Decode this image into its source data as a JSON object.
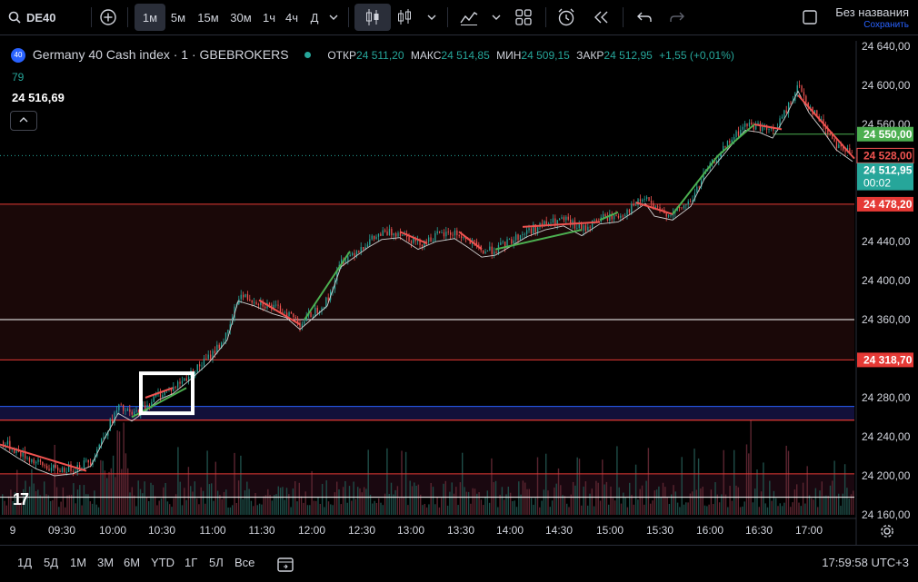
{
  "toolbar": {
    "symbol": "DE40",
    "timeframes": [
      "1м",
      "5м",
      "15м",
      "30м",
      "1ч",
      "4ч",
      "Д"
    ],
    "active_timeframe": "1м",
    "layout_title": "Без названия",
    "save_label": "Сохранить"
  },
  "legend": {
    "badge": "40",
    "title": "Germany 40 Cash index · 1 · GBEBROKERS",
    "open_label": "ОТКР",
    "open": "24 511,20",
    "high_label": "МАКС",
    "high": "24 514,85",
    "low_label": "МИН",
    "low": "24 509,15",
    "close_label": "ЗАКР",
    "close": "24 512,95",
    "change": "+1,55 (+0,01%)",
    "indicator_period": "79",
    "indicator_value": "24 516,69",
    "collapse_icon": "^"
  },
  "watermark": "17",
  "chart_data": {
    "type": "candlestick",
    "price_axis_labels": [
      "24 640,00",
      "24 600,00",
      "24 560,00",
      "24 440,00",
      "24 400,00",
      "24 360,00",
      "24 280,00",
      "24 240,00",
      "24 200,00",
      "24 160,00"
    ],
    "price_ticks": [
      24640,
      24600,
      24560,
      24440,
      24400,
      24360,
      24280,
      24240,
      24200,
      24160
    ],
    "time_axis_labels": [
      "9",
      "09:30",
      "10:00",
      "10:30",
      "11:00",
      "11:30",
      "12:00",
      "12:30",
      "13:00",
      "13:30",
      "14:00",
      "14:30",
      "15:00",
      "15:30",
      "16:00",
      "16:30",
      "17:00"
    ],
    "price_tags": [
      {
        "label": "24 550,00",
        "value": 24550,
        "style": "green"
      },
      {
        "label": "24 528,00",
        "value": 24528,
        "style": "red-outline"
      },
      {
        "label": "24 512,95",
        "sub": "00:02",
        "value": 24512.95,
        "style": "teal"
      },
      {
        "label": "24 478,20",
        "value": 24478.2,
        "style": "red"
      },
      {
        "label": "24 318,70",
        "value": 24318.7,
        "style": "red"
      }
    ],
    "horizontal_levels": [
      24478.2,
      24360,
      24318.7,
      24271,
      24257,
      24202,
      24178
    ],
    "colors": {
      "up": "#26a69a",
      "down": "#ef5350",
      "green_line": "#4caf50",
      "red_line": "#ef5350",
      "level_red": "#e53935",
      "level_white": "#ffffff",
      "level_blue": "#2962ff"
    },
    "price_path": [
      [
        0,
        24236
      ],
      [
        20,
        24224
      ],
      [
        40,
        24213
      ],
      [
        60,
        24206
      ],
      [
        80,
        24208
      ],
      [
        100,
        24216
      ],
      [
        115,
        24244
      ],
      [
        130,
        24270
      ],
      [
        145,
        24262
      ],
      [
        160,
        24272
      ],
      [
        175,
        24284
      ],
      [
        190,
        24290
      ],
      [
        210,
        24305
      ],
      [
        230,
        24322
      ],
      [
        250,
        24345
      ],
      [
        262,
        24385
      ],
      [
        280,
        24380
      ],
      [
        300,
        24372
      ],
      [
        315,
        24368
      ],
      [
        330,
        24356
      ],
      [
        345,
        24368
      ],
      [
        360,
        24380
      ],
      [
        375,
        24420
      ],
      [
        390,
        24430
      ],
      [
        405,
        24440
      ],
      [
        420,
        24448
      ],
      [
        440,
        24450
      ],
      [
        460,
        24438
      ],
      [
        480,
        24446
      ],
      [
        500,
        24449
      ],
      [
        515,
        24440
      ],
      [
        530,
        24430
      ],
      [
        545,
        24432
      ],
      [
        560,
        24440
      ],
      [
        580,
        24451
      ],
      [
        600,
        24458
      ],
      [
        620,
        24462
      ],
      [
        640,
        24452
      ],
      [
        660,
        24464
      ],
      [
        680,
        24466
      ],
      [
        695,
        24475
      ],
      [
        710,
        24485
      ],
      [
        720,
        24472
      ],
      [
        740,
        24468
      ],
      [
        760,
        24482
      ],
      [
        775,
        24510
      ],
      [
        790,
        24528
      ],
      [
        805,
        24545
      ],
      [
        820,
        24560
      ],
      [
        835,
        24558
      ],
      [
        850,
        24552
      ],
      [
        865,
        24575
      ],
      [
        878,
        24600
      ],
      [
        890,
        24578
      ],
      [
        905,
        24560
      ],
      [
        920,
        24540
      ],
      [
        938,
        24528
      ]
    ]
  },
  "bottombar": {
    "ranges": [
      "1Д",
      "5Д",
      "1М",
      "3М",
      "6М",
      "YTD",
      "1Г",
      "5Л",
      "Все"
    ],
    "clock": "17:59:58 UTC+3"
  }
}
